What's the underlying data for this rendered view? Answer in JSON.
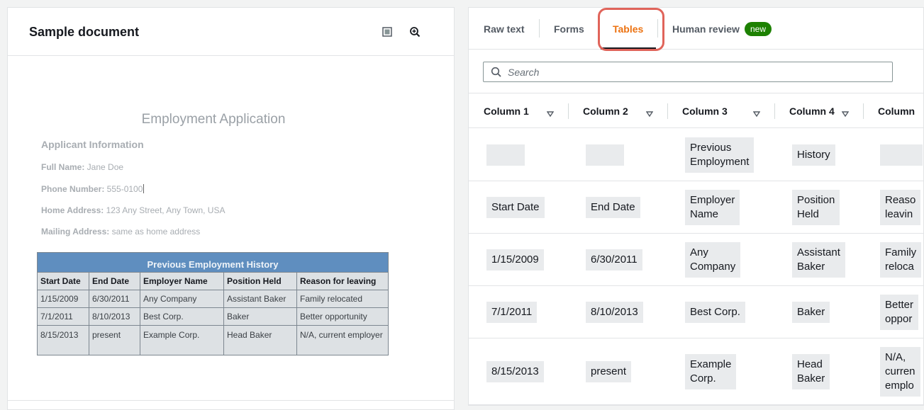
{
  "left": {
    "title": "Sample document",
    "icons": [
      "square-icon",
      "zoom-in-icon"
    ],
    "doc": {
      "heading": "Employment Application",
      "section": "Applicant Information",
      "fields": [
        {
          "label": "Full Name:",
          "value": " Jane Doe"
        },
        {
          "label": "Phone Number:",
          "value": " 555-0100"
        },
        {
          "label": "Home Address:",
          "value": " 123 Any Street, Any Town, USA"
        },
        {
          "label": "Mailing Address:",
          "value": " same as home address"
        }
      ],
      "table": {
        "caption": "Previous Employment History",
        "headers": [
          "Start Date",
          "End Date",
          "Employer Name",
          "Position Held",
          "Reason for leaving"
        ],
        "rows": [
          [
            "1/15/2009",
            "6/30/2011",
            "Any Company",
            "Assistant Baker",
            "Family relocated"
          ],
          [
            "7/1/2011",
            "8/10/2013",
            "Best Corp.",
            "Baker",
            "Better opportunity"
          ],
          [
            "8/15/2013",
            "present",
            "Example Corp.",
            "Head Baker",
            "N/A, current employer"
          ]
        ]
      }
    }
  },
  "right": {
    "tabs": {
      "raw": "Raw text",
      "forms": "Forms",
      "tables": "Tables",
      "review": "Human review",
      "badge": "new"
    },
    "search": {
      "placeholder": "Search"
    },
    "columns": [
      "Column 1",
      "Column 2",
      "Column 3",
      "Column 4",
      "Column"
    ],
    "rows": [
      [
        "",
        "",
        "Previous\nEmployment",
        "History",
        ""
      ],
      [
        "Start Date",
        "End Date",
        "Employer\nName",
        "Position\nHeld",
        "Reaso\nleavin"
      ],
      [
        "1/15/2009",
        "6/30/2011",
        "Any\nCompany",
        "Assistant\nBaker",
        "Family\nreloca"
      ],
      [
        "7/1/2011",
        "8/10/2013",
        "Best Corp.",
        "Baker",
        "Better\noppor"
      ],
      [
        "8/15/2013",
        "present",
        "Example\nCorp.",
        "Head\nBaker",
        "N/A,\ncurren\nemplo"
      ]
    ]
  },
  "colors": {
    "accent": "#ec7211",
    "badge": "#1d8102",
    "highlight": "#e0645a",
    "doc_table_header": "#5f8ebf"
  }
}
